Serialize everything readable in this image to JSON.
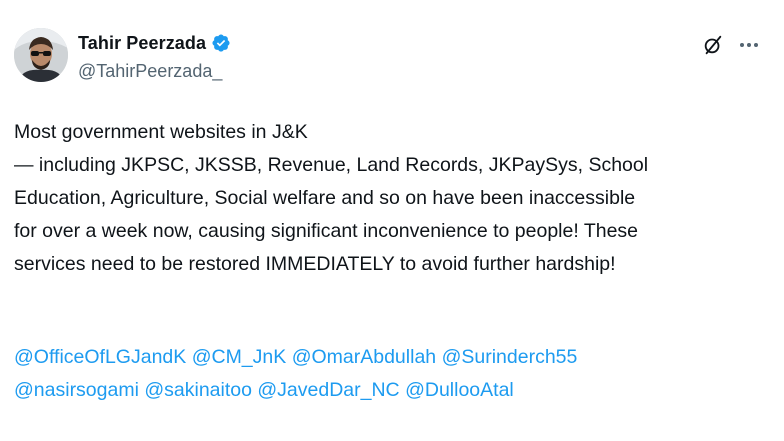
{
  "author": {
    "display_name": "Tahir Peerzada",
    "handle": "@TahirPeerzada_",
    "verified": true,
    "avatar_icon": "profile-photo"
  },
  "actions": {
    "grok_icon": "grok-icon",
    "more_icon": "more-options-icon"
  },
  "tweet": {
    "body": "Most government websites in J&K\n — including JKPSC, JKSSB, Revenue, Land Records, JKPaySys, School\nEducation, Agriculture, Social welfare and so on have been inaccessible\nfor over a week now, causing significant inconvenience to people! These\nservices need to be restored IMMEDIATELY to avoid further hardship!",
    "mentions_line1": [
      "@OfficeOfLGJandK",
      "@CM_JnK",
      "@OmarAbdullah",
      "@Surinderch55"
    ],
    "mentions_line2": [
      "@nasirsogami",
      "@sakinaitoo",
      "@JavedDar_NC",
      "@DullooAtal"
    ]
  },
  "colors": {
    "link": "#1d9bf0",
    "text": "#0f1419",
    "secondary": "#536471"
  }
}
